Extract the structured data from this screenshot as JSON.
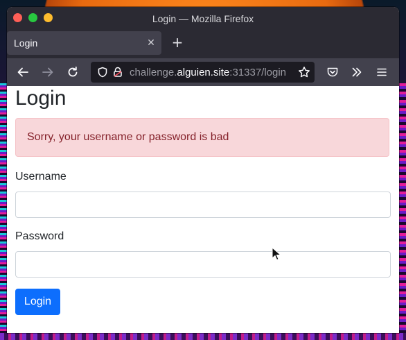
{
  "window": {
    "title": "Login — Mozilla Firefox"
  },
  "tabs": [
    {
      "label": "Login",
      "active": true
    }
  ],
  "icons": {
    "close_tab": "close-icon",
    "new_tab": "plus-icon",
    "back": "arrow-left-icon",
    "forward": "arrow-right-icon",
    "reload": "reload-icon",
    "tracking_protection": "shield-icon",
    "site_info": "lock-icon",
    "bookmark": "star-icon",
    "pocket": "pocket-icon",
    "overflow": "chevrons-right-icon",
    "menu": "hamburger-menu-icon"
  },
  "urlbar": {
    "prefix": "challenge.",
    "host": "alguien.site",
    "suffix": ":31337/login"
  },
  "page": {
    "title": "Login",
    "alert": "Sorry, your username or password is bad",
    "username_label": "Username",
    "username_value": "",
    "password_label": "Password",
    "password_value": "",
    "submit_label": "Login"
  },
  "colors": {
    "alert_bg": "#f8d7da",
    "alert_text": "#842029",
    "primary": "#0d6efd",
    "browser_chrome": "#2b2a33"
  }
}
